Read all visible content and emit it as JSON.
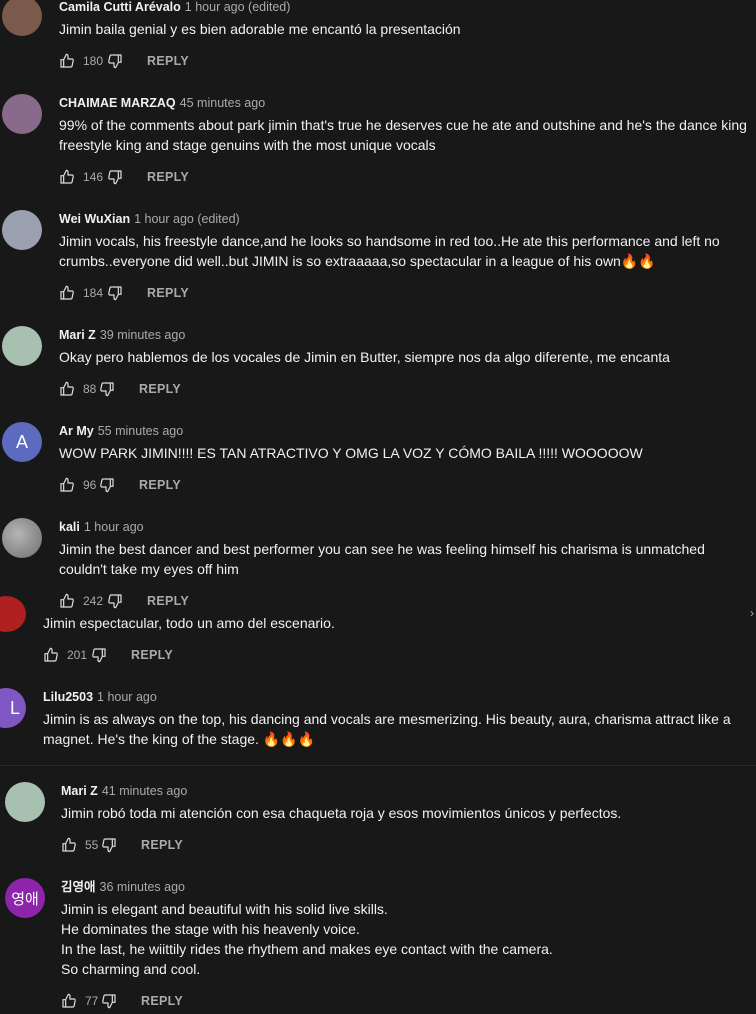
{
  "comments": [
    {
      "author": "Camila Cutti Arévalo",
      "time": "1 hour ago (edited)",
      "text": "Jimin baila genial y es bien adorable me encantó la presentación",
      "likes": "180",
      "reply": "REPLY",
      "avatar_color": "#7a5a4a"
    },
    {
      "author": "CHAIMAE MARZAQ",
      "time": "45 minutes ago",
      "text": "99% of the comments about park jimin that's true he deserves cue he ate and outshine and he's the dance king freestyle king and stage genuins with the most unique vocals",
      "likes": "146",
      "reply": "REPLY",
      "avatar_color": "#8a6a8a"
    },
    {
      "author": "Wei WuXian",
      "time": "1 hour ago (edited)",
      "text": "Jimin vocals, his freestyle dance,and he looks so handsome in red too..He ate this performance and left no crumbs..everyone did well..but JIMIN  is so extraaaaa,so spectacular in a league of his own🔥🔥",
      "likes": "184",
      "reply": "REPLY",
      "avatar_color": "#9aa0b0"
    },
    {
      "author": "Mari Z",
      "time": "39 minutes ago",
      "text": "Okay pero hablemos de los vocales de Jimin en Butter, siempre nos da algo diferente, me encanta",
      "likes": "88",
      "reply": "REPLY",
      "avatar_color": "#a8c0b0"
    },
    {
      "author": "Ar My",
      "time": "55 minutes ago",
      "text": "WOW PARK JIMIN!!!! ES TAN ATRACTIVO Y OMG LA VOZ Y CÓMO BAILA !!!!! WOOOOOW",
      "likes": "96",
      "reply": "REPLY",
      "avatar_letter": "A",
      "avatar_color": "#5c6bc0"
    },
    {
      "author": "kali",
      "time": "1 hour ago",
      "text": "Jimin the best dancer and best performer you can see he was feeling himself his charisma is unmatched couldn't take my eyes off him",
      "likes": "242",
      "reply": "REPLY",
      "avatar_color": "#8a8a8a"
    },
    {
      "author": "",
      "time": "",
      "text": "Jimin espectacular, todo un amo del escenario.",
      "likes": "201",
      "reply": "REPLY",
      "avatar_color": "#b02020"
    },
    {
      "author": "Lilu2503",
      "time": "1 hour ago",
      "text": "Jimin is as always on  the  top, his dancing and vocals are mesmerizing. His beauty, aura, charisma attract like a magnet. He's the king of the stage. 🔥🔥🔥",
      "likes": "",
      "reply": "",
      "avatar_letter": "L",
      "avatar_color": "#7e57c2"
    },
    {
      "author": "Mari Z",
      "time": "41 minutes ago",
      "text": "Jimin robó toda mi atención con esa chaqueta roja y esos movimientos únicos y perfectos.",
      "likes": "55",
      "reply": "REPLY",
      "avatar_color": "#a8c0b0"
    },
    {
      "author": "김영애",
      "time": "36 minutes ago",
      "text": "Jimin is elegant and beautiful with his solid live skills.\nHe dominates the stage with his heavenly voice.\nIn the last, he wiittily rides the rhythem and makes eye contact with the camera.\nSo charming and cool.",
      "likes": "77",
      "reply": "REPLY",
      "avatar_letter": "영애",
      "avatar_color": "#8e24aa"
    }
  ],
  "icons": {
    "like": "thumb-up-icon",
    "dislike": "thumb-down-icon"
  }
}
